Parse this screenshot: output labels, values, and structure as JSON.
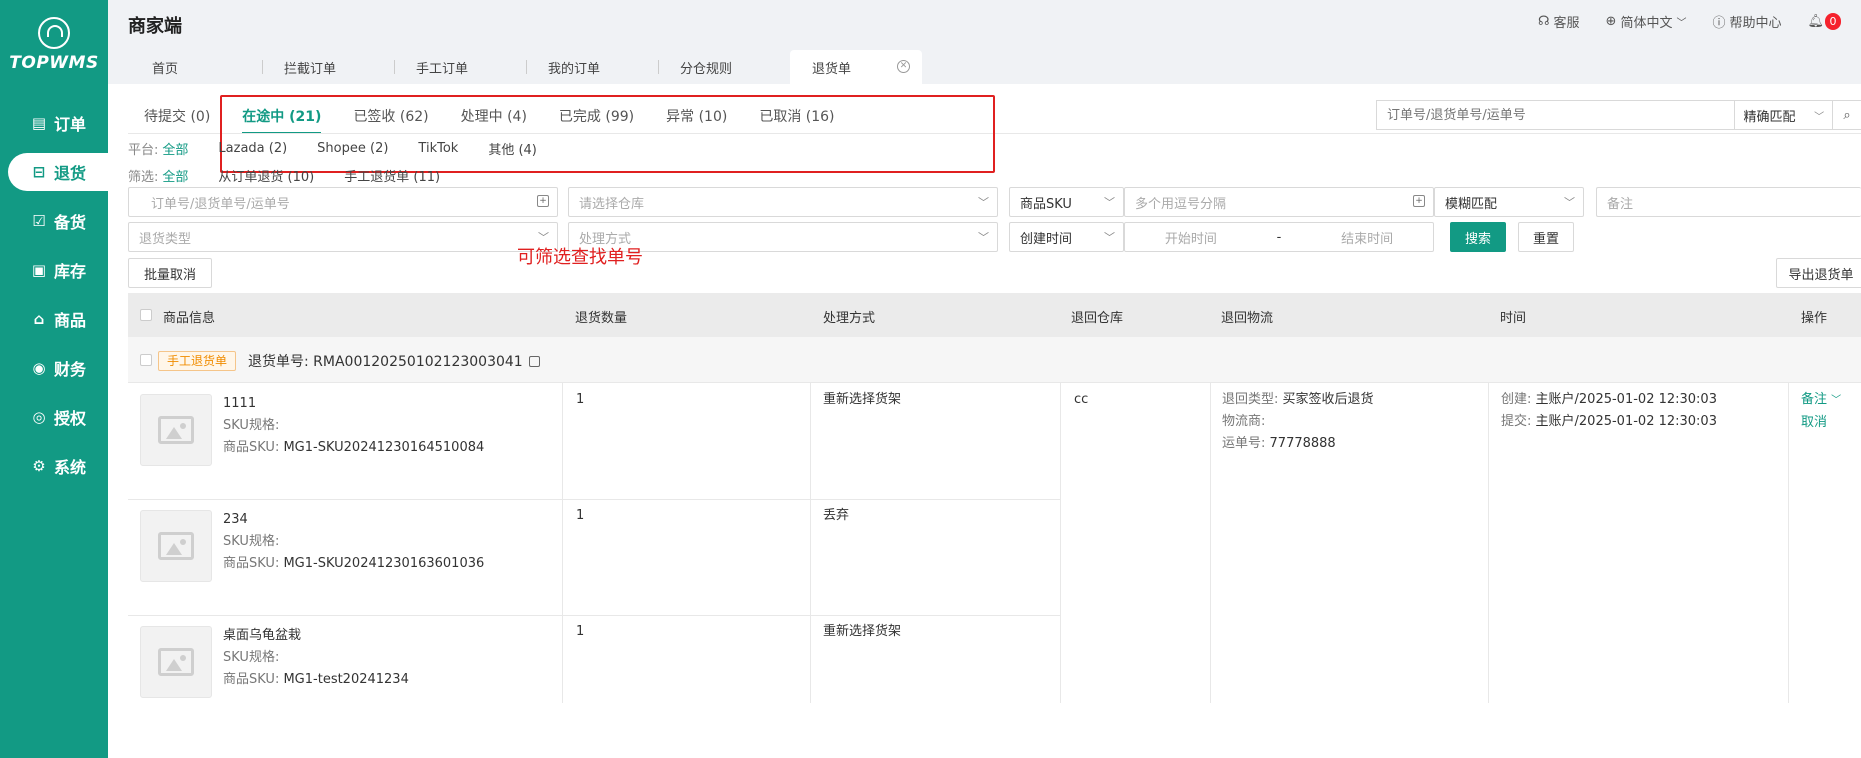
{
  "app": {
    "logo_text": "TOPWMS",
    "brand": "商家端",
    "service": "客服",
    "language": "简体中文",
    "help": "帮助中心",
    "notification_count": "0"
  },
  "sidebar": {
    "items": [
      {
        "label": "订单",
        "icon": "order-icon"
      },
      {
        "label": "退货",
        "icon": "return-icon",
        "active": true
      },
      {
        "label": "备货",
        "icon": "stock-prep-icon"
      },
      {
        "label": "库存",
        "icon": "inventory-icon"
      },
      {
        "label": "商品",
        "icon": "product-icon"
      },
      {
        "label": "财务",
        "icon": "finance-icon"
      },
      {
        "label": "授权",
        "icon": "auth-icon"
      },
      {
        "label": "系统",
        "icon": "system-icon"
      }
    ]
  },
  "page_tabs": [
    "首页",
    "拦截订单",
    "手工订单",
    "我的订单",
    "分仓规则",
    "退货单"
  ],
  "status_tabs": [
    "待提交 (0)",
    "在途中 (21)",
    "已签收 (62)",
    "处理中 (4)",
    "已完成 (99)",
    "异常 (10)",
    "已取消 (16)"
  ],
  "top_search": {
    "placeholder": "订单号/退货单号/运单号",
    "match": "精确匹配"
  },
  "filters": {
    "platform_label": "平台:",
    "platforms": [
      "全部",
      "Lazada (2)",
      "Shopee (2)",
      "TikTok",
      "其他 (4)"
    ],
    "screen_label": "筛选:",
    "screens": [
      "全部",
      "从订单退货 (10)",
      "手工退货单 (11)"
    ],
    "order_no_placeholder": "订单号/退货单号/运单号",
    "warehouse_placeholder": "请选择仓库",
    "sku_select": "商品SKU",
    "multi_no_placeholder": "多个用逗号分隔",
    "fuzzy_match": "模糊匹配",
    "remark_placeholder": "备注",
    "return_type_placeholder": "退货类型",
    "process_placeholder": "处理方式",
    "time_select": "创建时间",
    "start_time": "开始时间",
    "range_sep": "-",
    "end_time": "结束时间",
    "search_btn": "搜索",
    "reset_btn": "重置",
    "batch_cancel": "批量取消",
    "export": "导出退货单"
  },
  "annotation": "可筛选查找单号",
  "table": {
    "headers": [
      "商品信息",
      "退货数量",
      "处理方式",
      "退回仓库",
      "退回物流",
      "时间",
      "操作"
    ],
    "group": {
      "tag": "手工退货单",
      "order_label": "退货单号:",
      "order_no": "RMA00120250102123003041",
      "warehouse": "cc",
      "logistics": {
        "type_label": "退回类型:",
        "type": "买家签收后退货",
        "carrier_label": "物流商:",
        "tracking_label": "运单号:",
        "tracking": "77778888"
      },
      "time": {
        "created_label": "创建:",
        "created": "主账户/2025-01-02 12:30:03",
        "submitted_label": "提交:",
        "submitted": "主账户/2025-01-02 12:30:03"
      },
      "actions": {
        "remark": "备注",
        "cancel": "取消"
      }
    },
    "rows": [
      {
        "name": "1111",
        "sku_spec_label": "SKU规格:",
        "sku_label": "商品SKU:",
        "sku": "MG1-SKU20241230164510084",
        "qty": "1",
        "process": "重新选择货架"
      },
      {
        "name": "234",
        "sku_spec_label": "SKU规格:",
        "sku_label": "商品SKU:",
        "sku": "MG1-SKU20241230163601036",
        "qty": "1",
        "process": "丢弃"
      },
      {
        "name": "桌面乌龟盆栽",
        "sku_spec_label": "SKU规格:",
        "sku_label": "商品SKU:",
        "sku": "MG1-test20241234",
        "qty": "1",
        "process": "重新选择货架"
      }
    ]
  },
  "colors": {
    "primary": "#129a84",
    "highlight": "#e02020",
    "tag": "#f08c00"
  }
}
